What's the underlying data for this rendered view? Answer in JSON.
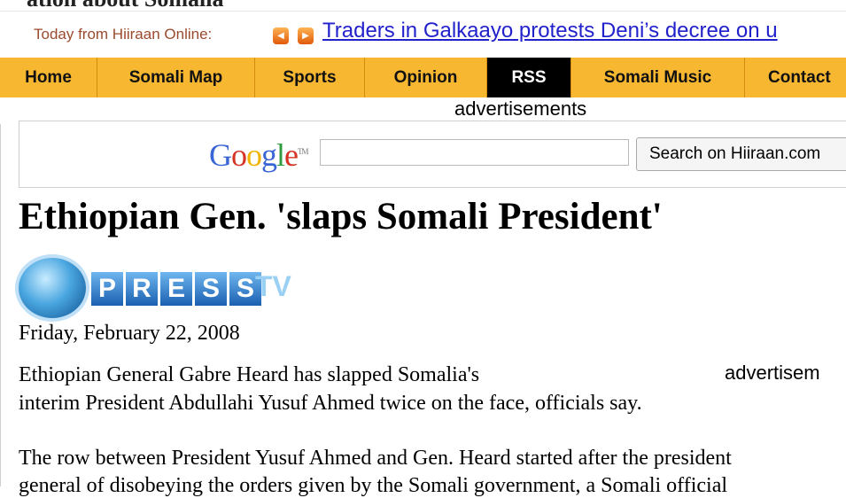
{
  "header_cut": {
    "text": "ation about Somalia"
  },
  "ticker": {
    "label": "Today from Hiiraan Online:",
    "prev_glyph": "◀",
    "next_glyph": "▶",
    "headline": "Traders in Galkaayo protests Deni’s decree on u"
  },
  "nav": {
    "items": [
      {
        "label": "Home"
      },
      {
        "label": "Somali Map"
      },
      {
        "label": "Sports"
      },
      {
        "label": "Opinion"
      },
      {
        "label": "RSS",
        "active": true
      },
      {
        "label": "Somali Music"
      },
      {
        "label": "Contact"
      }
    ],
    "bar_color": "#f7b731",
    "active_color": "#000000"
  },
  "ads": {
    "label": "advertisements",
    "label_cut": "advertisem"
  },
  "search": {
    "logo_text": "Google",
    "logo_tm": "TM",
    "input_value": "",
    "button_label": "Search on Hiiraan.com"
  },
  "article": {
    "headline": "Ethiopian Gen. 'slaps Somali President'",
    "source_logo": {
      "letters": [
        "P",
        "R",
        "E",
        "S",
        "S"
      ],
      "suffix": "TV"
    },
    "date": "Friday, February 22, 2008",
    "p1_line1": "Ethiopian General Gabre Heard has slapped Somalia's",
    "p1_line2": "interim President Abdullahi Yusuf Ahmed twice on the face, officials say.",
    "p2_line1": "The row between President Yusuf Ahmed and Gen. Heard started after the president",
    "p2_line2": "general of disobeying the orders given by the Somali government, a Somali official"
  }
}
